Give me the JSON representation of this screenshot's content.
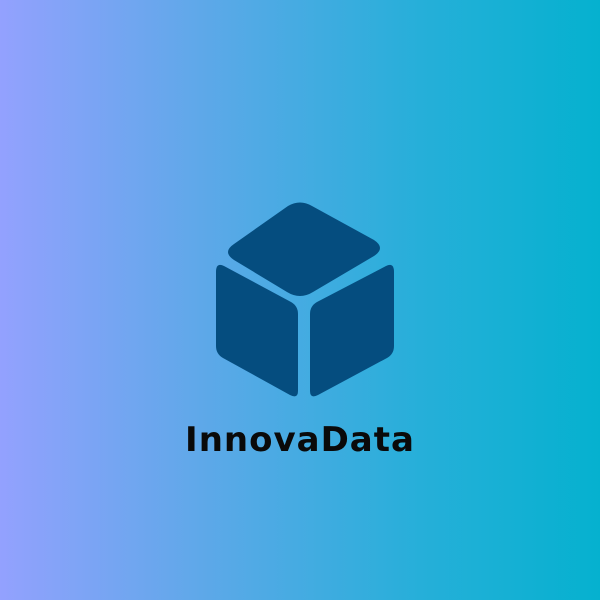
{
  "brand": {
    "name": "InnovaData"
  },
  "colors": {
    "background_gradient": [
      "#93A1FE",
      "#5FA8E9",
      "#26AFD9",
      "#05B1CF"
    ],
    "cube": "#054D7F",
    "text": "#0A0A0A"
  },
  "icons": {
    "logo_mark": "cube-icon"
  }
}
